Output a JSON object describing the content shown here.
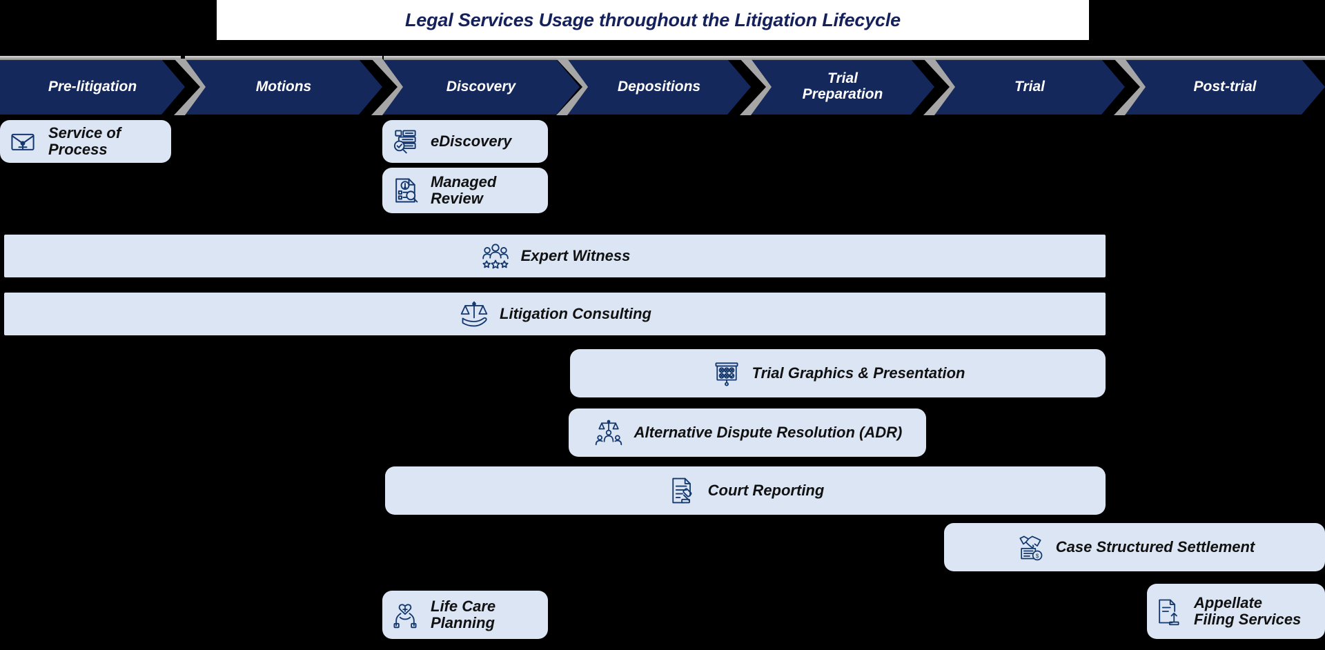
{
  "title": {
    "text": "Legal Services Usage throughout the Litigation Lifecycle"
  },
  "colors": {
    "background": "#000000",
    "title_bar": "#FFFFFF",
    "title_text": "#14215B",
    "phase_fill": "#14285C",
    "phase_text": "#FFFFFF",
    "separator": "#A6A6A6",
    "service_fill": "#DBE5F3",
    "service_icon": "#14386E",
    "service_text": "#111111"
  },
  "phases": [
    {
      "label": "Pre-litigation"
    },
    {
      "label": "Motions"
    },
    {
      "label": "Discovery"
    },
    {
      "label": "Depositions"
    },
    {
      "label": "Trial\nPreparation"
    },
    {
      "label": "Trial"
    },
    {
      "label": "Post-trial"
    }
  ],
  "services": [
    {
      "label": "Service of\nProcess",
      "icon": "envelope-document-icon",
      "spans": "Pre-litigation"
    },
    {
      "label": "eDiscovery",
      "icon": "server-search-icon",
      "spans": "Discovery"
    },
    {
      "label": "Managed\nReview",
      "icon": "document-review-icon",
      "spans": "Discovery"
    },
    {
      "label": "Expert Witness",
      "icon": "people-stars-icon",
      "spans": "Pre-litigation to Post-trial"
    },
    {
      "label": "Litigation Consulting",
      "icon": "scales-hand-icon",
      "spans": "Pre-litigation to Post-trial"
    },
    {
      "label": "Trial Graphics & Presentation",
      "icon": "presentation-board-icon",
      "spans": "Depositions to Post-trial"
    },
    {
      "label": "Alternative Dispute Resolution (ADR)",
      "icon": "mediation-scales-icon",
      "spans": "Depositions to Trial"
    },
    {
      "label": "Court Reporting",
      "icon": "document-gavel-icon",
      "spans": "Discovery to Post-trial"
    },
    {
      "label": "Case Structured Settlement",
      "icon": "handshake-money-icon",
      "spans": "Trial to Post-trial"
    },
    {
      "label": "Life Care\nPlanning",
      "icon": "hands-heart-icon",
      "spans": "Discovery"
    },
    {
      "label": "Appellate\nFiling Services",
      "icon": "filing-upload-icon",
      "spans": "Post-trial"
    }
  ]
}
